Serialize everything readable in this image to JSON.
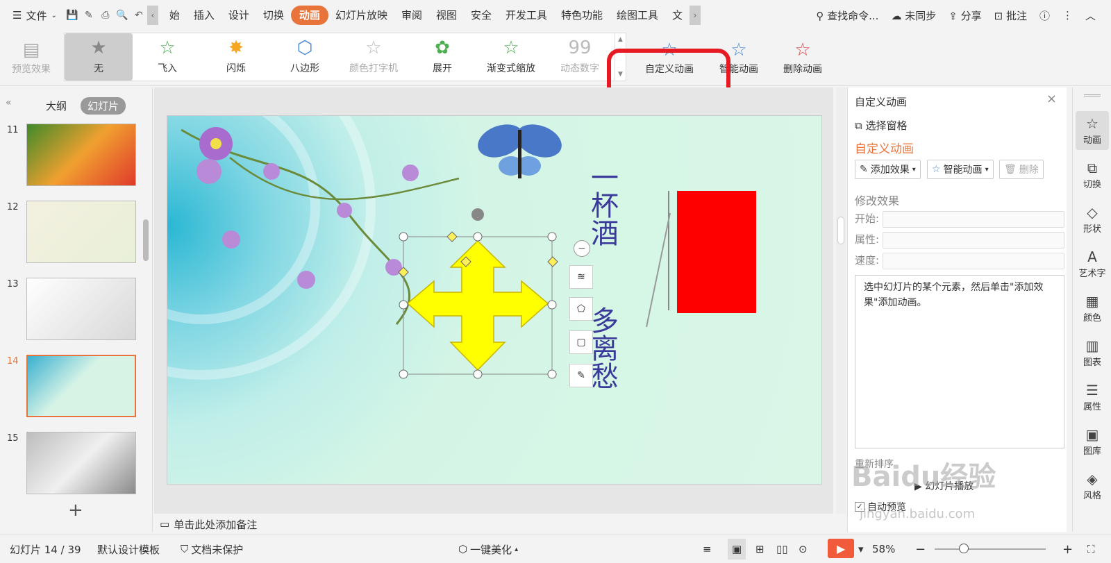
{
  "menubar": {
    "file_label": "文件",
    "tabs": [
      "始",
      "插入",
      "设计",
      "切换",
      "动画",
      "幻灯片放映",
      "审阅",
      "视图",
      "安全",
      "开发工具",
      "特色功能",
      "绘图工具",
      "文"
    ],
    "search_placeholder": "查找命令...",
    "sync_label": "未同步",
    "share_label": "分享",
    "comment_label": "批注"
  },
  "ribbon": {
    "preview_label": "预览效果",
    "gallery": [
      {
        "label": "无",
        "selected": true,
        "disabled": false
      },
      {
        "label": "飞入",
        "selected": false,
        "disabled": false
      },
      {
        "label": "闪烁",
        "selected": false,
        "disabled": false
      },
      {
        "label": "八边形",
        "selected": false,
        "disabled": false
      },
      {
        "label": "颜色打字机",
        "selected": false,
        "disabled": true
      },
      {
        "label": "展开",
        "selected": false,
        "disabled": false
      },
      {
        "label": "渐变式缩放",
        "selected": false,
        "disabled": false
      },
      {
        "label": "动态数字",
        "selected": false,
        "disabled": true
      }
    ],
    "custom_anim_label": "自定义动画",
    "smart_anim_label": "智能动画",
    "delete_anim_label": "删除动画"
  },
  "left_panel": {
    "tab_outline": "大纲",
    "tab_slides": "幻灯片",
    "slides": [
      {
        "num": "11",
        "current": false
      },
      {
        "num": "12",
        "current": false
      },
      {
        "num": "13",
        "current": false
      },
      {
        "num": "14",
        "current": true
      },
      {
        "num": "15",
        "current": false
      }
    ],
    "add_label": "+"
  },
  "slide": {
    "poem_line1": "一杯酒",
    "poem_line2": "多离愁"
  },
  "notes": {
    "placeholder": "单击此处添加备注"
  },
  "right_panel": {
    "title": "自定义动画",
    "select_pane": "选择窗格",
    "section_title": "自定义动画",
    "add_effect": "添加效果",
    "smart_anim": "智能动画",
    "delete": "删除",
    "modify_title": "修改效果",
    "start_label": "开始:",
    "property_label": "属性:",
    "speed_label": "速度:",
    "hint": "选中幻灯片的某个元素，然后单击\"添加效果\"添加动画。",
    "reorder_label": "重新排序",
    "play_label": "幻灯片播放",
    "auto_preview": "自动预览"
  },
  "sidebar": {
    "items": [
      {
        "label": "动画",
        "icon": "☆",
        "active": true
      },
      {
        "label": "切换",
        "icon": "⧉",
        "active": false
      },
      {
        "label": "形状",
        "icon": "◇",
        "active": false
      },
      {
        "label": "艺术字",
        "icon": "A",
        "active": false
      },
      {
        "label": "颜色",
        "icon": "▦",
        "active": false
      },
      {
        "label": "图表",
        "icon": "▥",
        "active": false
      },
      {
        "label": "属性",
        "icon": "☰",
        "active": false
      },
      {
        "label": "图库",
        "icon": "▣",
        "active": false
      },
      {
        "label": "风格",
        "icon": "◈",
        "active": false
      }
    ]
  },
  "statusbar": {
    "slide_count": "幻灯片 14 / 39",
    "template": "默认设计模板",
    "protect": "文档未保护",
    "beautify": "一键美化",
    "zoom": "58%",
    "zoom_fraction": 0.58
  },
  "watermark": {
    "brand": "Baidu经验",
    "url": "jingyan.baidu.com"
  },
  "colors": {
    "accent": "#e8743b",
    "highlight_box": "#e51a22",
    "shape_fill": "#ffff00",
    "rect_fill": "#ff0000",
    "play": "#f15a3a"
  }
}
